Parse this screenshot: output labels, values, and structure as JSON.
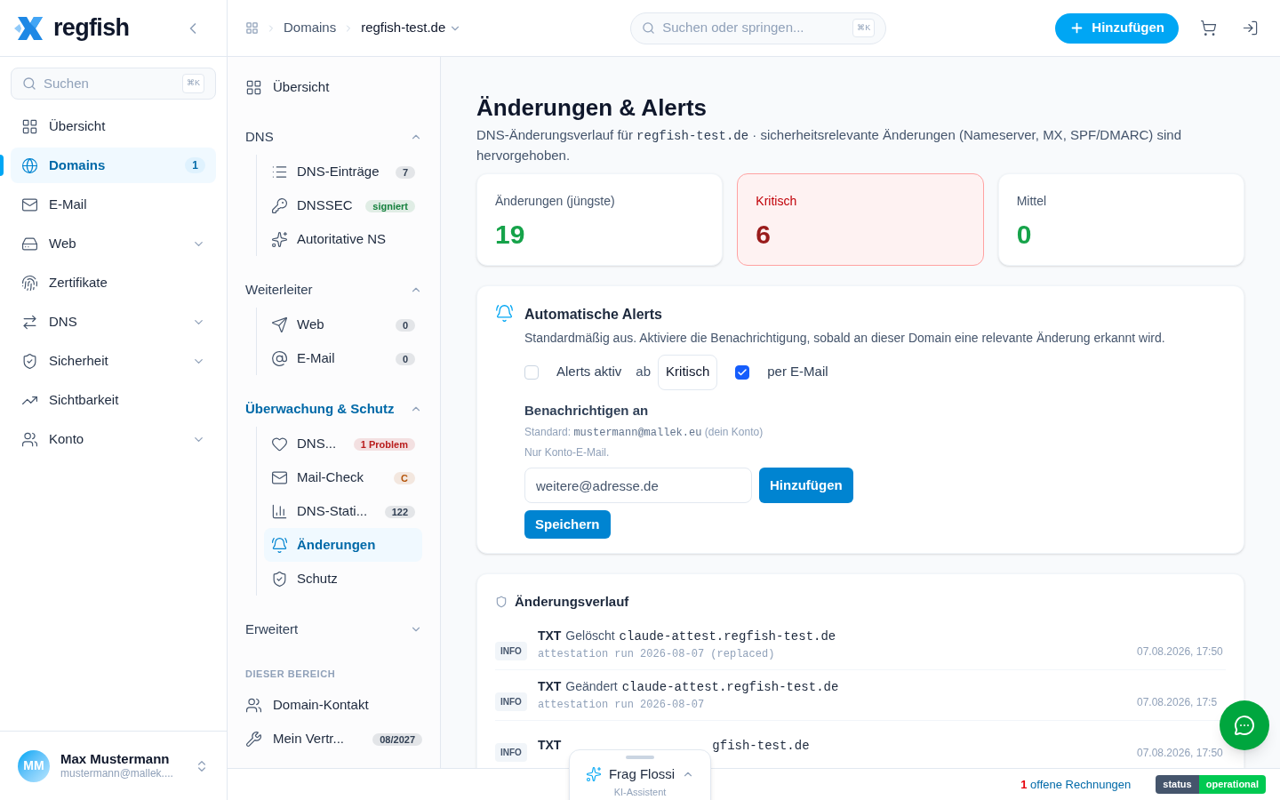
{
  "brand": {
    "name": "regfish"
  },
  "sidebar": {
    "search": {
      "placeholder": "Suchen",
      "shortcut": "⌘K"
    },
    "items": [
      {
        "label": "Übersicht",
        "selected": false
      },
      {
        "label": "Domains",
        "selected": true,
        "count": "1"
      },
      {
        "label": "E-Mail",
        "selected": false
      },
      {
        "label": "Web",
        "selected": false,
        "expanded": false
      },
      {
        "label": "Zertifikate",
        "selected": false
      },
      {
        "label": "DNS",
        "selected": false,
        "expanded": false
      },
      {
        "label": "Sicherheit",
        "selected": false,
        "expanded": false
      },
      {
        "label": "Sichtbarkeit",
        "selected": false
      },
      {
        "label": "Konto",
        "selected": false,
        "expanded": false
      }
    ],
    "user": {
      "initials": "MM",
      "name": "Max Mustermann",
      "email": "mustermann@mallek...."
    }
  },
  "header": {
    "breadcrumb": [
      "Domains",
      "regfish-test.de"
    ],
    "search": {
      "placeholder": "Suchen oder springen...",
      "shortcut": "⌘K"
    },
    "add_button": "Hinzufügen"
  },
  "subnav": {
    "overview": "Übersicht",
    "sections": [
      {
        "title": "DNS",
        "expanded": true,
        "active": false,
        "items": [
          {
            "label": "DNS-Einträge",
            "selected": false,
            "badge": {
              "text": "7",
              "color": "#334155"
            }
          },
          {
            "label": "DNSSEC",
            "selected": false,
            "badge": {
              "text": "signiert",
              "color": "#15803d"
            }
          },
          {
            "label": "Autoritative NS",
            "selected": false
          }
        ]
      },
      {
        "title": "Weiterleiter",
        "expanded": true,
        "active": false,
        "items": [
          {
            "label": "Web",
            "selected": false,
            "badge": {
              "text": "0",
              "color": "#334155"
            }
          },
          {
            "label": "E-Mail",
            "selected": false,
            "badge": {
              "text": "0",
              "color": "#334155"
            }
          }
        ]
      },
      {
        "title": "Überwachung & Schutz",
        "expanded": true,
        "active": true,
        "items": [
          {
            "label": "DNS...",
            "selected": false,
            "badge": {
              "text": "1 Problem",
              "color": "#b91c1c"
            }
          },
          {
            "label": "Mail-Check",
            "selected": false,
            "badge": {
              "text": "C",
              "color": "#b45309"
            }
          },
          {
            "label": "DNS-Stati...",
            "selected": false,
            "badge": {
              "text": "122",
              "color": "#334155"
            }
          },
          {
            "label": "Änderungen",
            "selected": true
          },
          {
            "label": "Schutz",
            "selected": false
          }
        ]
      },
      {
        "title": "Erweitert",
        "expanded": false,
        "active": false
      }
    ],
    "area_label": "DIESER BEREICH",
    "area_items": [
      {
        "label": "Domain-Kontakt"
      },
      {
        "label": "Mein Vertr...",
        "badge": {
          "text": "08/2027",
          "color": "#334155"
        }
      }
    ]
  },
  "page": {
    "title": "Änderungen & Alerts",
    "intro_before": "DNS-Änderungsverlauf für",
    "intro_domain": "regfish-test.de",
    "intro_after": "· sicherheitsrelevante Änderungen (Nameserver, MX, SPF/DMARC) sind hervorgehoben."
  },
  "stats": [
    {
      "label": "Änderungen (jüngste)",
      "value": "19",
      "color": "#16a34a",
      "highlighted": false
    },
    {
      "label": "Kritisch",
      "value": "6",
      "color": "#991b1b",
      "highlighted": true
    },
    {
      "label": "Mittel",
      "value": "0",
      "color": "#16a34a",
      "highlighted": false
    }
  ],
  "alerts": {
    "title": "Automatische Alerts",
    "description": "Standardmäßig aus. Aktiviere die Benachrichtigung, sobald an dieser Domain eine relevante Änderung erkannt wird.",
    "active": {
      "label": "Alerts aktiv",
      "checked": false
    },
    "from_label": "ab",
    "level": "Kritisch",
    "email": {
      "label": "per E-Mail",
      "checked": true
    },
    "notify_title": "Benachrichtigen an",
    "default_before": "Standard:",
    "default_email": "mustermann@mallek.eu",
    "default_after": "(dein Konto)",
    "hint": "Nur Konto-E-Mail.",
    "input_placeholder": "weitere@adresse.de",
    "add_button": "Hinzufügen",
    "save_button": "Speichern"
  },
  "history": {
    "title": "Änderungsverlauf",
    "rows": [
      {
        "level": "INFO",
        "type": "TXT",
        "action": "Gelöscht",
        "record": "claude-attest.regfish-test.de",
        "detail": "attestation run 2026-08-07 (replaced)",
        "time": "07.08.2026, 17:50"
      },
      {
        "level": "INFO",
        "type": "TXT",
        "action": "Geändert",
        "record": "claude-attest.regfish-test.de",
        "detail": "attestation run 2026-08-07",
        "time": "07.08.2026, 17:5"
      },
      {
        "level": "INFO",
        "type": "TXT",
        "record": "gfish-test.de",
        "time": "07.08.2026, 17:50"
      }
    ]
  },
  "assistant": {
    "title": "Frag Flossi",
    "subtitle": "KI-Assistent"
  },
  "footer": {
    "invoice_count": "1",
    "invoice_label": "offene Rechnungen",
    "status_label": "status",
    "status_value": "operational"
  }
}
